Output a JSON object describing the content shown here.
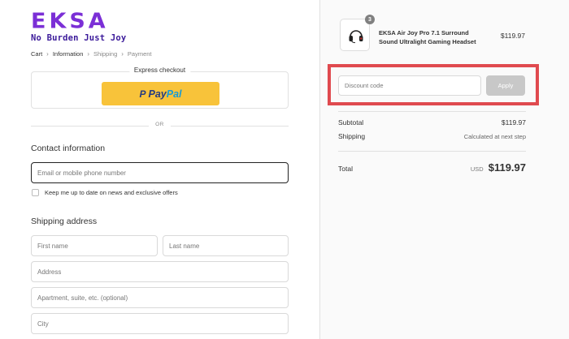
{
  "brand": {
    "logo_text": "EKSA",
    "tagline": "No Burden Just Joy",
    "logo_color": "#7b2fd6"
  },
  "breadcrumb": {
    "items": [
      "Cart",
      "Information",
      "Shipping",
      "Payment"
    ],
    "current": "Information"
  },
  "express": {
    "title": "Express checkout",
    "paypal_pay": "Pay",
    "paypal_pal": "Pal",
    "paypal_color": "#f8c33a"
  },
  "divider": {
    "or_label": "OR"
  },
  "contact": {
    "title": "Contact information",
    "email_placeholder": "Email or mobile phone number",
    "newsletter_label": "Keep me up to date on news and exclusive offers"
  },
  "shipping_address": {
    "title": "Shipping address",
    "first_name_placeholder": "First name",
    "last_name_placeholder": "Last name",
    "address_placeholder": "Address",
    "apartment_placeholder": "Apartment, suite, etc. (optional)",
    "city_placeholder": "City"
  },
  "order": {
    "product": {
      "name": "EKSA Air Joy Pro 7.1 Surround Sound Ultralight Gaming Headset",
      "quantity": "3",
      "price": "$119.97",
      "icon": "headset-icon"
    },
    "discount": {
      "placeholder": "Discount code",
      "apply_label": "Apply",
      "highlight_color": "#e04a4f"
    },
    "subtotal_label": "Subtotal",
    "subtotal_value": "$119.97",
    "shipping_label": "Shipping",
    "shipping_value": "Calculated at next step",
    "total_label": "Total",
    "currency": "USD",
    "total_value": "$119.97"
  }
}
